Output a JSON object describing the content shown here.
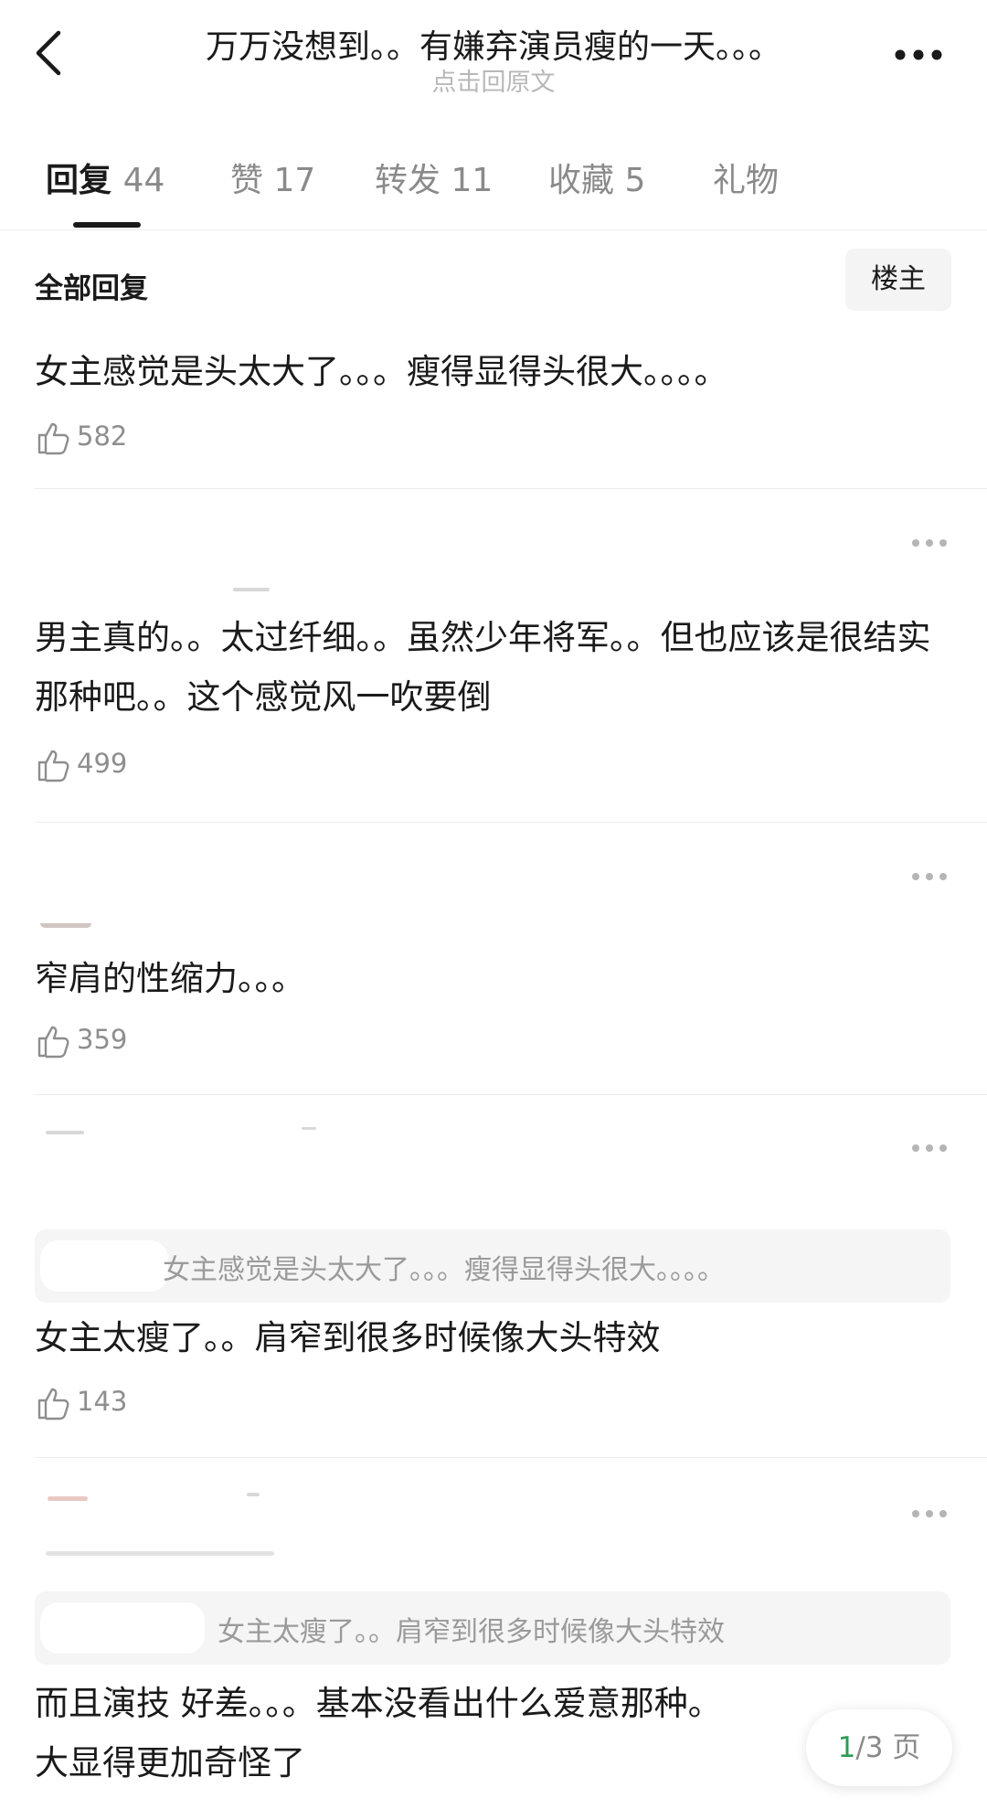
{
  "header": {
    "title": "万万没想到。。有嫌弃演员瘦的一天。。。",
    "subtitle": "点击回原文"
  },
  "tabs": [
    {
      "label": "回复",
      "count": "44"
    },
    {
      "label": "赞",
      "count": "17"
    },
    {
      "label": "转发",
      "count": "11"
    },
    {
      "label": "收藏",
      "count": "5"
    },
    {
      "label": "礼物",
      "count": ""
    }
  ],
  "filter": {
    "label": "全部回复",
    "op_label": "楼主"
  },
  "comments": [
    {
      "text": "女主感觉是头太大了。。。瘦得显得头很大。。。。",
      "likes": "582"
    },
    {
      "text": "男主真的。。太过纤细。。虽然少年将军。。但也应该是很结实那种吧。。这个感觉风一吹要倒",
      "likes": "499"
    },
    {
      "text": "窄肩的性缩力。。。",
      "likes": "359"
    },
    {
      "text": "女主太瘦了。。肩窄到很多时候像大头特效",
      "likes": "143",
      "quote": "女主感觉是头太大了。。。瘦得显得头很大。。。。"
    },
    {
      "text": "而且演技 好差。。。基本没看出什么爱意那种。",
      "text_line2": "大显得更加奇怪了",
      "quote": "女主太瘦了。。肩窄到很多时候像大头特效"
    }
  ],
  "pagination": {
    "current": "1",
    "rest": "/3 页"
  },
  "colors": {
    "accent_page": "#2e9a55",
    "muted_text": "#8a8a8a",
    "quote_bg": "#f5f5f5"
  },
  "icons": [
    "back-arrow-icon",
    "more-icon",
    "thumbs-up-icon",
    "ellipsis-icon"
  ]
}
